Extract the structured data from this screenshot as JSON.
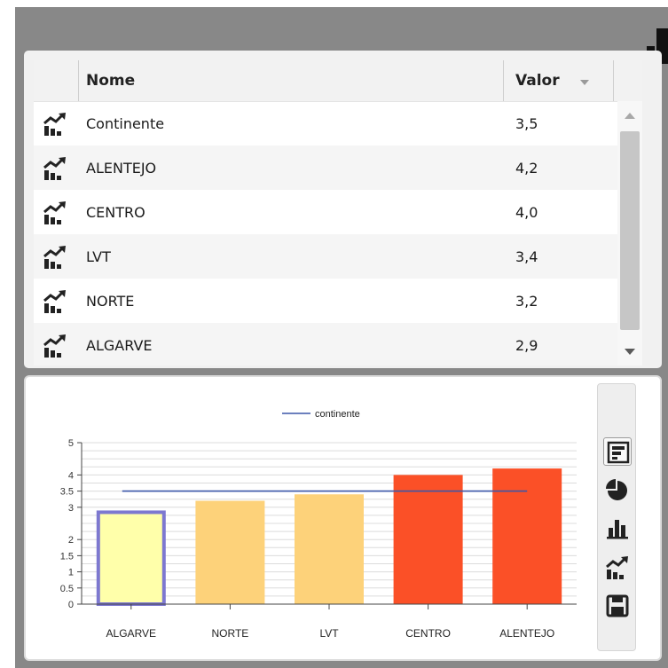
{
  "table": {
    "headers": {
      "name": "Nome",
      "value": "Valor"
    },
    "sort": {
      "column": "value",
      "direction": "descending"
    },
    "rows": [
      {
        "name": "Continente",
        "value": "3,5"
      },
      {
        "name": "ALENTEJO",
        "value": "4,2"
      },
      {
        "name": "CENTRO",
        "value": "4,0"
      },
      {
        "name": "LVT",
        "value": "3,4"
      },
      {
        "name": "NORTE",
        "value": "3,2"
      },
      {
        "name": "ALGARVE",
        "value": "2,9"
      }
    ],
    "row_icon": "line-bar-chart-icon"
  },
  "corner_icon": "bar-chart-icon",
  "toolbar": {
    "items": [
      {
        "icon": "horizontal-bars-icon",
        "active": true
      },
      {
        "icon": "pie-chart-icon",
        "active": false
      },
      {
        "icon": "bar-chart-icon",
        "active": false
      },
      {
        "icon": "line-bar-chart-icon",
        "active": false
      },
      {
        "icon": "save-icon",
        "active": false
      }
    ]
  },
  "chart_data": {
    "type": "bar",
    "categories": [
      "ALGARVE",
      "NORTE",
      "LVT",
      "CENTRO",
      "ALENTEJO"
    ],
    "values": [
      2.9,
      3.2,
      3.4,
      4.0,
      4.2
    ],
    "bar_colors": [
      "#ffffaa",
      "#fdd27a",
      "#fdd27a",
      "#fb5027",
      "#fb5027"
    ],
    "highlighted": "ALGARVE",
    "highlight_color": "#7d78d0",
    "reference_line": {
      "name": "continente",
      "value": 3.5,
      "color": "#3b56a8"
    },
    "ylim": [
      0,
      5
    ],
    "yticks": [
      0,
      0.5,
      1,
      1.5,
      2,
      3,
      3.5,
      4,
      5
    ],
    "ytick_labels": [
      "0",
      "0.5",
      "1",
      "1.5",
      "2",
      "3",
      "3.5",
      "4",
      "5"
    ],
    "legend": {
      "position": "top-center",
      "label": "continente"
    },
    "grid": true
  }
}
